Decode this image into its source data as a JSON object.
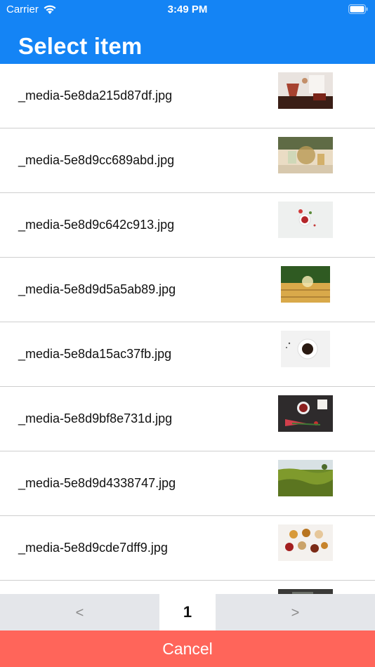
{
  "status_bar": {
    "carrier": "Carrier",
    "time": "3:49 PM"
  },
  "header": {
    "title": "Select item"
  },
  "items": [
    {
      "filename": "_media-5e8da215d87df.jpg",
      "thumb": "tea-pouring"
    },
    {
      "filename": "_media-5e8d9cc689abd.jpg",
      "thumb": "glass-teapot"
    },
    {
      "filename": "_media-5e8d9c642c913.jpg",
      "thumb": "red-tea-cup"
    },
    {
      "filename": "_media-5e8d9d5a5ab89.jpg",
      "thumb": "tea-on-table"
    },
    {
      "filename": "_media-5e8da15ac37fb.jpg",
      "thumb": "black-coffee"
    },
    {
      "filename": "_media-5e8d9bf8e731d.jpg",
      "thumb": "tea-with-tulips"
    },
    {
      "filename": "_media-5e8d9d4338747.jpg",
      "thumb": "tea-plantation"
    },
    {
      "filename": "_media-5e8d9cde7dff9.jpg",
      "thumb": "assorted-teas"
    },
    {
      "filename": "",
      "thumb": "partial-image"
    }
  ],
  "pagination": {
    "prev": "<",
    "page": "1",
    "next": ">"
  },
  "cancel_label": "Cancel"
}
